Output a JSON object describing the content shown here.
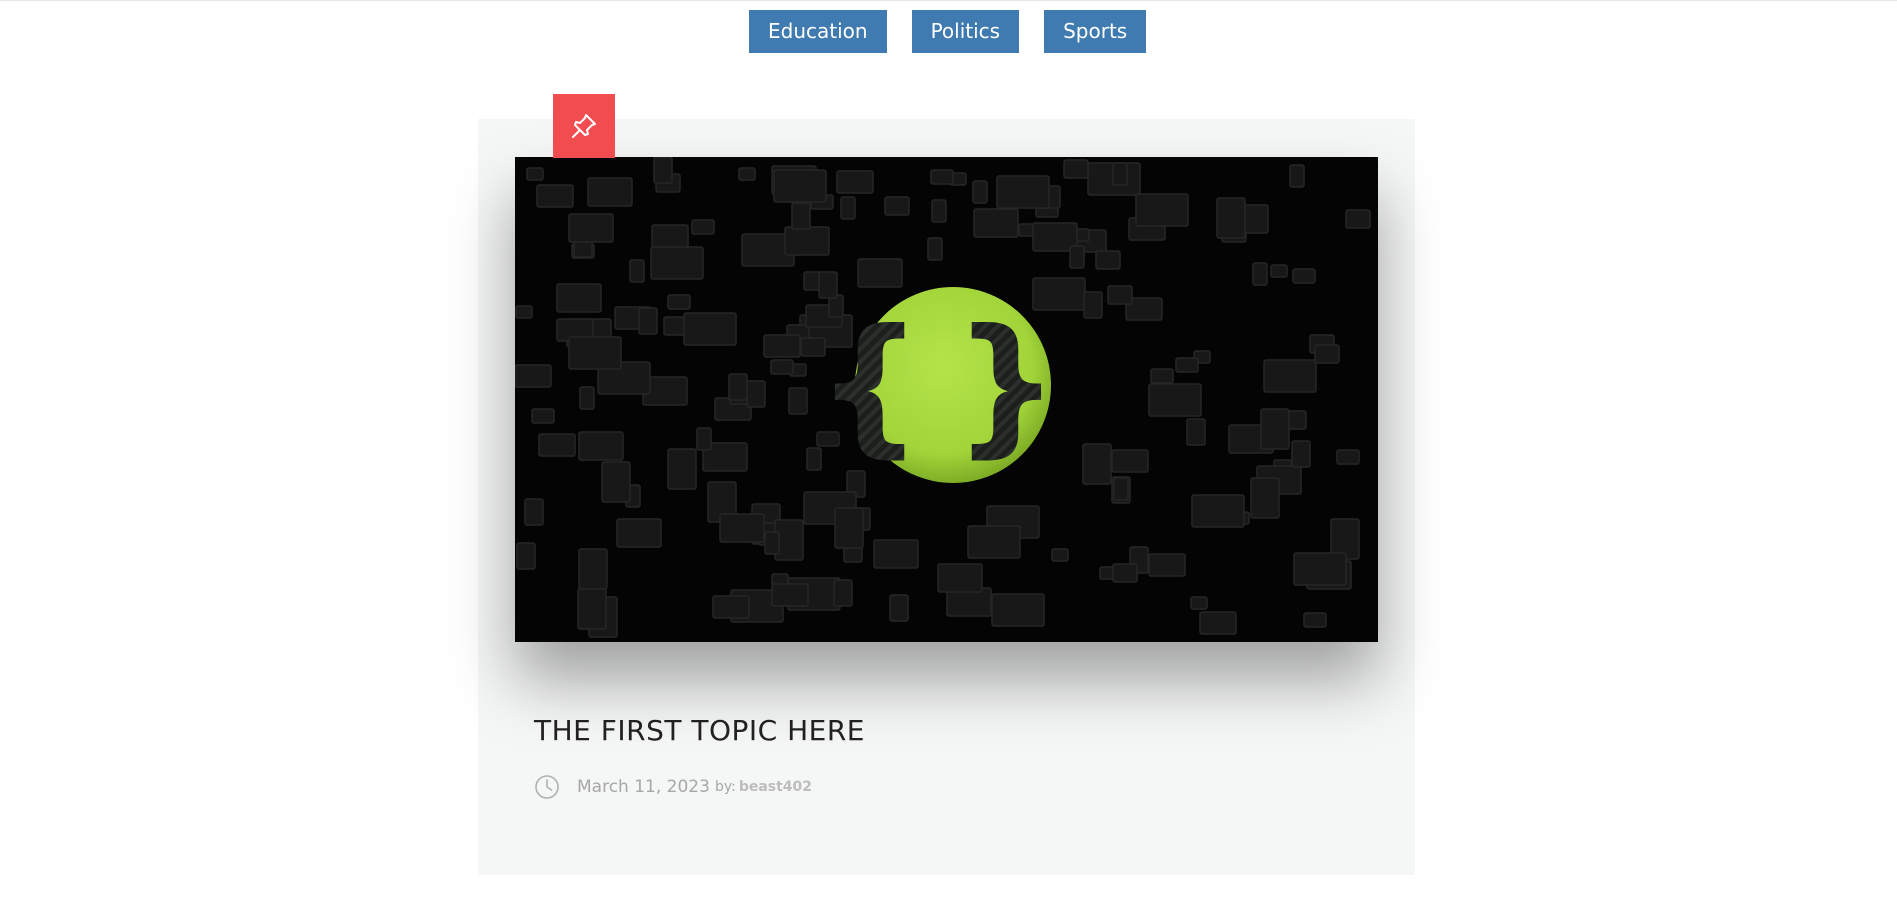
{
  "categories": [
    {
      "label": "Education"
    },
    {
      "label": "Politics"
    },
    {
      "label": "Sports"
    }
  ],
  "post": {
    "title": "THE FIRST TOPIC HERE",
    "date": "March 11, 2023",
    "by_label": "by:",
    "author": "beast402",
    "pinned": true,
    "image_logo": "curly-braces-logo"
  },
  "colors": {
    "category_button": "#3f7bb0",
    "pin_badge": "#f14c4f",
    "card_background": "#f5f6f6",
    "logo_green": "#a6d83c"
  },
  "icons": {
    "pin": "pushpin-icon",
    "clock": "clock-icon"
  }
}
